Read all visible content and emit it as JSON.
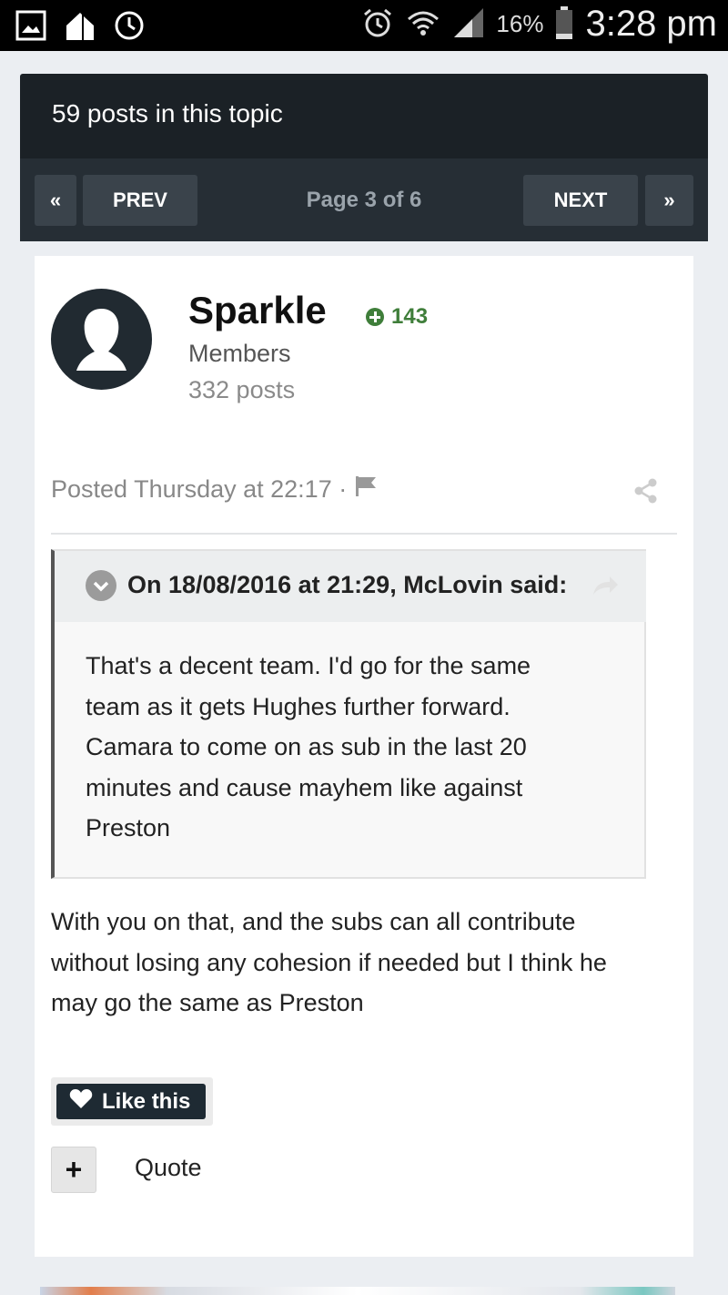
{
  "status_bar": {
    "battery_percent": "16%",
    "time": "3:28 pm"
  },
  "topic": {
    "post_count_label": "59 posts in this topic"
  },
  "pagination": {
    "first_symbol": "«",
    "prev_label": "PREV",
    "page_info": "Page 3 of 6",
    "next_label": "NEXT",
    "last_symbol": "»"
  },
  "post": {
    "author": {
      "name": "Sparkle",
      "reputation": "143",
      "group": "Members",
      "posts": "332 posts"
    },
    "meta": {
      "posted": "Posted Thursday at 22:17 ·"
    },
    "quote": {
      "citation": "On 18/08/2016 at 21:29, McLovin said:",
      "lines": [
        "That's a decent team. I'd go for the same",
        "team as it gets Hughes further forward.",
        "Camara to come on as sub in the last 20",
        "minutes and cause mayhem like against",
        "Preston"
      ]
    },
    "content_lines": [
      "With you on that, and the subs can all contribute",
      "without losing any cohesion if needed but I think he",
      "may go the same as Preston"
    ],
    "actions": {
      "like_label": "Like this",
      "quote_add_symbol": "+",
      "quote_label": "Quote"
    }
  },
  "colors": {
    "header_bg": "#1b2126",
    "pager_bg": "#262e35",
    "reputation_green": "#3f7e3a",
    "like_button_bg": "#1e2a33"
  },
  "icons": {
    "gallery": "image-icon",
    "home": "home-icon",
    "sync": "sync-icon",
    "alarm": "alarm-icon",
    "wifi": "wifi-icon",
    "signal": "signal-icon",
    "battery": "battery-icon",
    "avatar": "default-avatar-icon",
    "flag": "flag-icon",
    "share": "share-icon",
    "collapse": "chevron-down-icon",
    "jump": "reply-arrow-icon",
    "like": "heart-icon"
  }
}
